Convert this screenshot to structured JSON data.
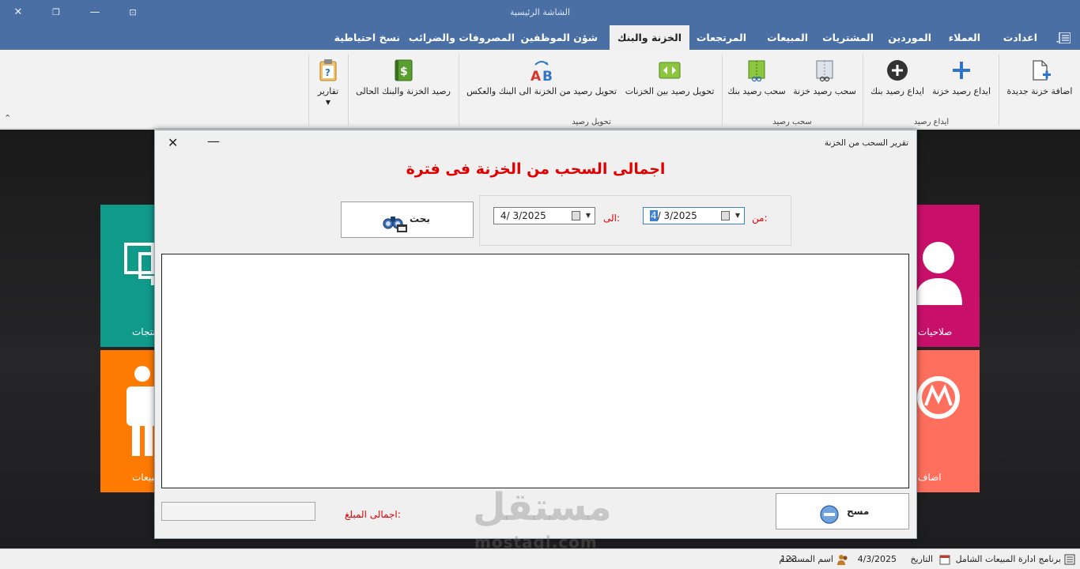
{
  "window": {
    "title": "الشاشة الرئيسية"
  },
  "tabs": [
    {
      "label": "اعدادت"
    },
    {
      "label": "العملاء"
    },
    {
      "label": "الموردين"
    },
    {
      "label": "المشتريات"
    },
    {
      "label": "المبيعات"
    },
    {
      "label": "المرتجعات"
    },
    {
      "label": "الخزنة والبنك"
    },
    {
      "label": "شؤن الموظفين"
    },
    {
      "label": "المصروفات والضرائب"
    },
    {
      "label": "نسخ احتياطية"
    }
  ],
  "active_tab": "الخزنة والبنك",
  "ribbon": {
    "add_safe": "اضافة خزنة جديدة",
    "deposit_safe": "ايداع رصيد خزنة",
    "deposit_bank": "ايداع رصيد بنك",
    "deposit_group": "ايداع رصيد",
    "withdraw_safe": "سحب رصيد خزنة",
    "withdraw_bank": "سحب رصيد بنك",
    "withdraw_group": "سحب رصيد",
    "transfer_safes": "تحويل رصيد بين الخزنات",
    "transfer_safe_bank": "تحويل رصيد من الخزنة الى البنك والعكس",
    "transfer_group": "تحويل رصيد",
    "current_balance": "رصيد الخزنة والبنك الحالى",
    "reports": "تقارير"
  },
  "tiles": {
    "products": "منتجات",
    "sales": "مبيعات",
    "permissions": "صلاحيات",
    "add": "اضاف"
  },
  "dialog": {
    "title": "تقرير السحب من الخزنة",
    "heading": "اجمالى السحب من الخزنة فى فترة",
    "from_label": "من:",
    "to_label": "الى:",
    "from_day": "4",
    "from_rest": "/  3/2025",
    "to_date": "4/  3/2025",
    "search_label": "بحث",
    "total_label": "اجمالى المبلغ:",
    "total_value": "",
    "clear_label": "مسح"
  },
  "watermark": {
    "main": "مستقل",
    "sub": "mostaql.com"
  },
  "status": {
    "app": "برنامج ادارة المبيعات الشامل",
    "date_label": "التاريخ",
    "date_value": "4/3/2025",
    "user_label": "اسم المستخدم",
    "user_value": "123"
  },
  "colors": {
    "titlebar": "#4a6fa5",
    "accent_red": "#e00000",
    "tile_teal": "#0f9a8a",
    "tile_orange": "#ff7a00",
    "tile_magenta": "#c8106a",
    "tile_salmon": "#ff6f5e"
  }
}
